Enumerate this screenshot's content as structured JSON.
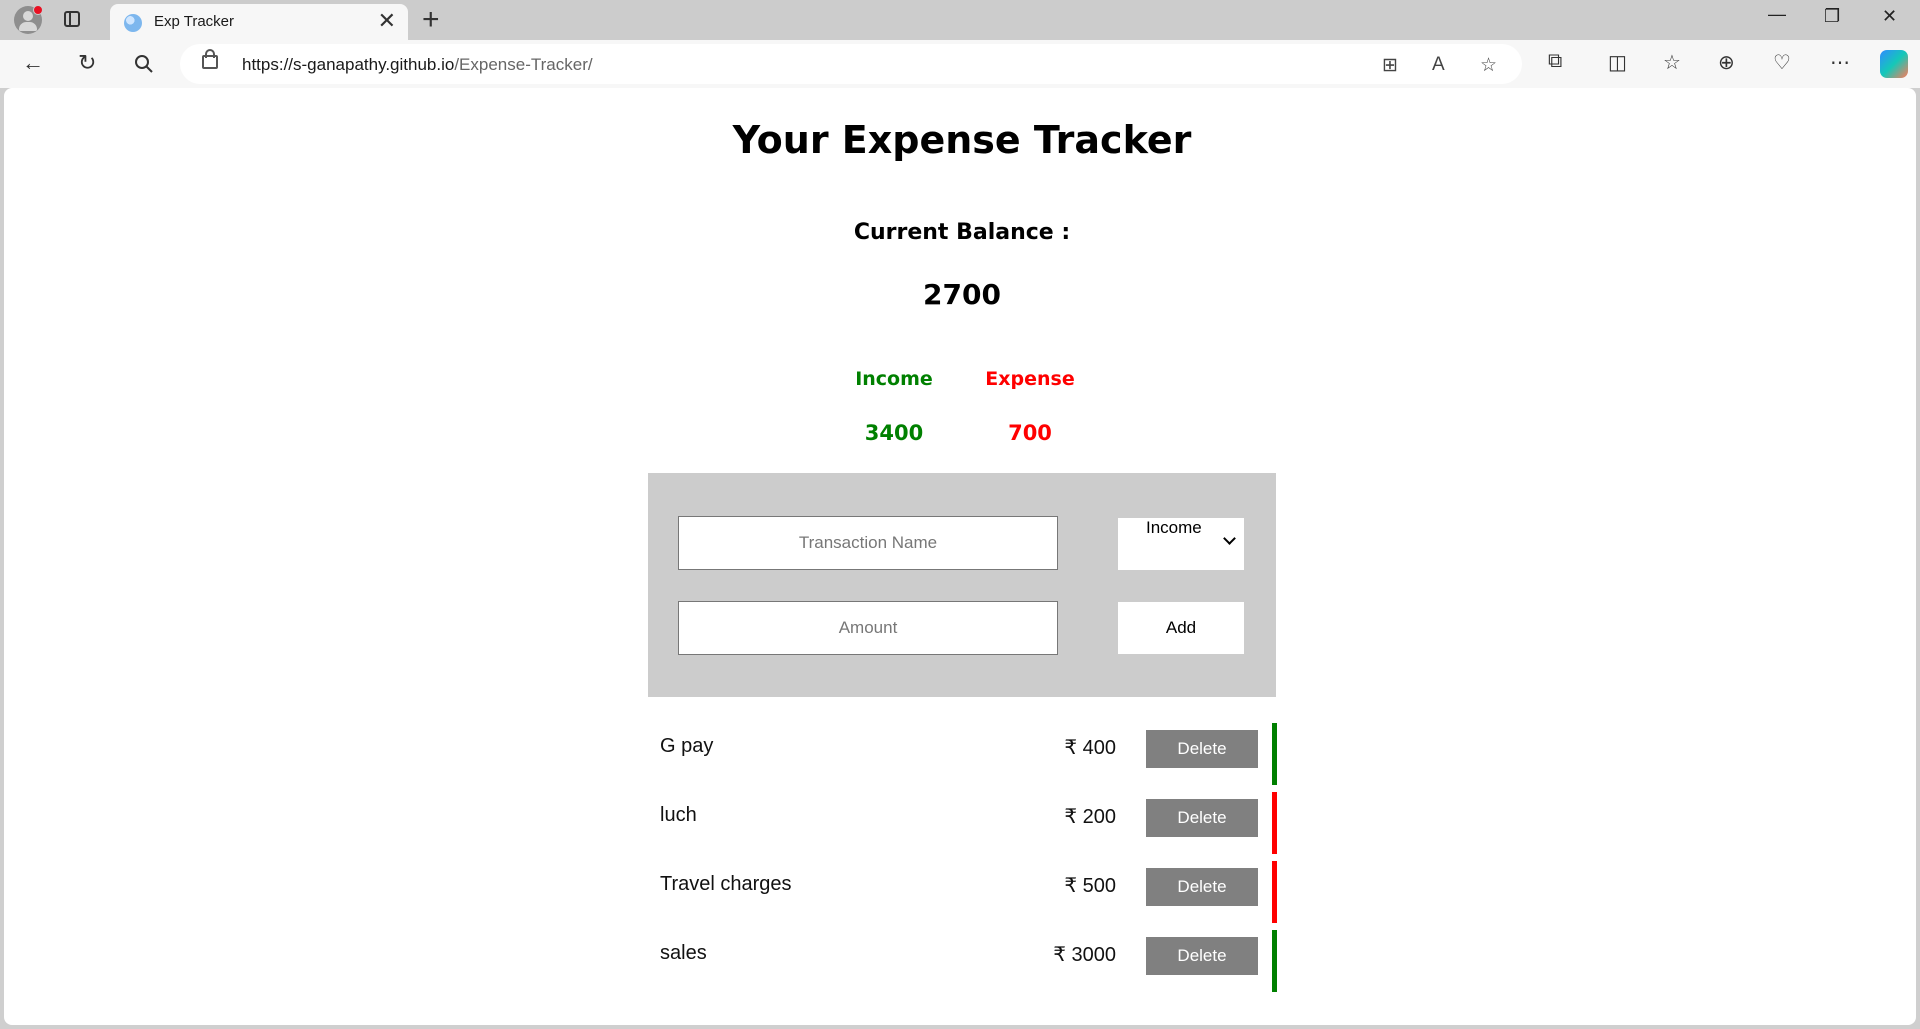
{
  "browser": {
    "tab_title": "Exp Tracker",
    "tab_close": "✕",
    "new_tab": "+",
    "url_host": "https://s-ganapathy.github.io",
    "url_path": "/Expense-Tracker/",
    "window_buttons": {
      "minimize": "—",
      "restore": "❐",
      "close": "✕"
    },
    "icons": [
      "profile-icon",
      "tab-actions-icon",
      "back-icon",
      "refresh-icon",
      "search-icon",
      "lock-icon",
      "app-available-icon",
      "read-aloud-icon",
      "favorite-icon",
      "extensions-icon",
      "split-screen-icon",
      "favorites-icon",
      "collections-icon",
      "browser-essentials-icon",
      "more-icon",
      "copilot-icon"
    ]
  },
  "app": {
    "title": "Your Expense Tracker",
    "balance_label": "Current Balance :",
    "balance_value": "2700",
    "income_label": "Income",
    "income_value": "3400",
    "expense_label": "Expense",
    "expense_value": "700",
    "form": {
      "name_placeholder": "Transaction Name",
      "amount_placeholder": "Amount",
      "type_selected": "Income",
      "add_label": "Add"
    },
    "transactions": [
      {
        "name": "G pay",
        "amount": "₹ 400",
        "delete_label": "Delete",
        "type": "income"
      },
      {
        "name": "luch",
        "amount": "₹ 200",
        "delete_label": "Delete",
        "type": "expense"
      },
      {
        "name": "Travel charges",
        "amount": "₹ 500",
        "delete_label": "Delete",
        "type": "expense"
      },
      {
        "name": "sales",
        "amount": "₹ 3000",
        "delete_label": "Delete",
        "type": "income"
      }
    ]
  },
  "colors": {
    "income": "#008000",
    "expense": "#ff0000",
    "panel": "#cccccc",
    "delete_button": "#808080"
  }
}
